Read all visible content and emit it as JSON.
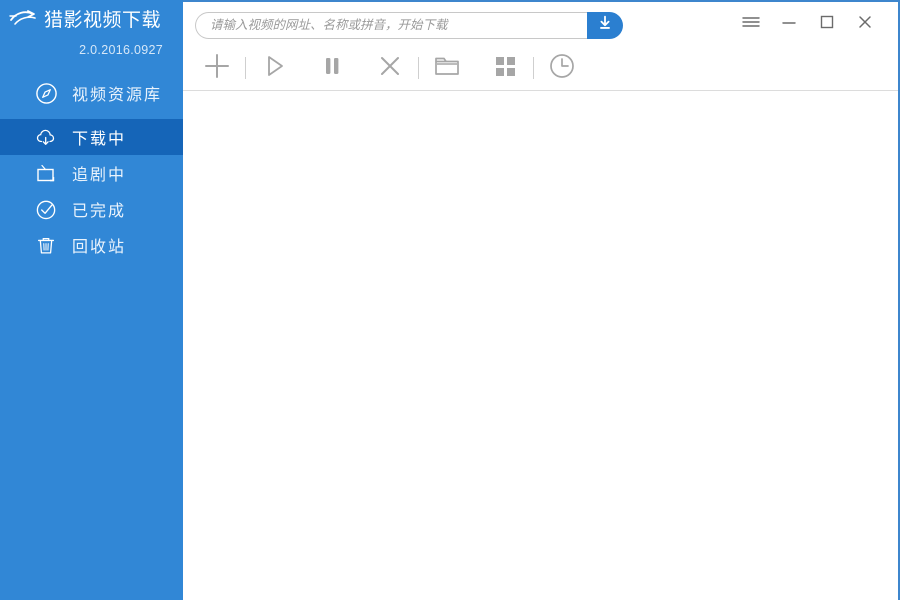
{
  "app": {
    "brand_title": "猎影视频下载",
    "version": "2.0.2016.0927",
    "logo_icon": "swoosh-logo-icon",
    "accent_color": "#3187d6",
    "accent_active_color": "#1565b8",
    "border_color": "#3e86cd",
    "button_blue": "#2b7fd0"
  },
  "sidebar": {
    "items": [
      {
        "label": "视频资源库",
        "icon": "compass-icon",
        "active": false
      },
      {
        "label": "下载中",
        "icon": "cloud-download-icon",
        "active": true
      },
      {
        "label": "追剧中",
        "icon": "tv-icon",
        "active": false
      },
      {
        "label": "已完成",
        "icon": "check-circle-icon",
        "active": false
      },
      {
        "label": "回收站",
        "icon": "trash-icon",
        "active": false
      }
    ]
  },
  "search": {
    "placeholder": "请输入视频的网址、名称或拼音，开始下载",
    "value": "",
    "go_icon": "download-arrow-icon"
  },
  "window_controls": [
    {
      "name": "menu",
      "icon": "hamburger-menu-icon"
    },
    {
      "name": "minimize",
      "icon": "minimize-icon"
    },
    {
      "name": "maximize",
      "icon": "maximize-icon"
    },
    {
      "name": "close",
      "icon": "close-icon"
    }
  ],
  "toolbar": {
    "buttons": [
      {
        "name": "add",
        "icon": "plus-icon"
      },
      {
        "name": "start",
        "icon": "play-icon"
      },
      {
        "name": "pause",
        "icon": "pause-icon"
      },
      {
        "name": "delete",
        "icon": "close-x-icon"
      },
      {
        "name": "open-folder",
        "icon": "folder-icon"
      },
      {
        "name": "grid-view",
        "icon": "grid-icon"
      },
      {
        "name": "history",
        "icon": "clock-icon"
      }
    ]
  },
  "content": {
    "empty_text": ""
  }
}
